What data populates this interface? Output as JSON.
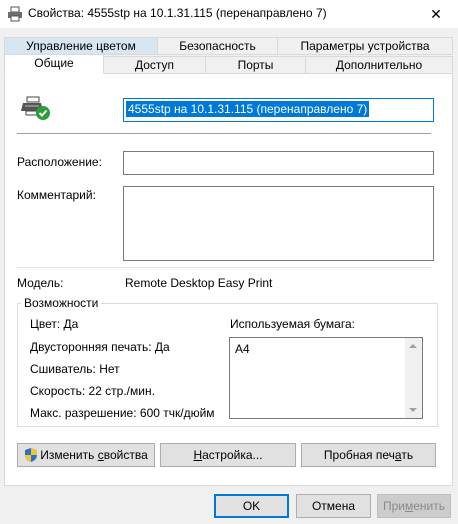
{
  "window": {
    "title": "Свойства: 4555stp на 10.1.31.115 (перенаправлено 7)",
    "close_glyph": "✕",
    "icons": {
      "title": "printer-icon",
      "close": "close-icon"
    }
  },
  "tabs_back": [
    "Управление цветом",
    "Безопасность",
    "Параметры устройства"
  ],
  "tabs_front": [
    "Общие",
    "Доступ",
    "Порты",
    "Дополнительно"
  ],
  "general": {
    "printer_icon": "printer-default-check-icon",
    "printer_name": "4555stp на 10.1.31.115 (перенаправлено 7)",
    "location_label": "Расположение:",
    "location_value": "",
    "comment_label": "Комментарий:",
    "comment_value": "",
    "model_label": "Модель:",
    "model_value": "Remote Desktop Easy Print"
  },
  "features": {
    "title": "Возможности",
    "color": "Цвет: Да",
    "duplex": "Двусторонняя печать: Да",
    "staple": "Сшиватель: Нет",
    "speed": "Скорость: 22 стр./мин.",
    "resolution": "Макс. разрешение: 600 тчк/дюйм",
    "paper_label": "Используемая бумага:",
    "paper_items": [
      "A4"
    ]
  },
  "panel_buttons": {
    "change_props_pre": "Изменить ",
    "change_props_u": "с",
    "change_props_post": "войства",
    "shield_icon": "uac-shield-icon",
    "settings_pre": "",
    "settings_u": "Н",
    "settings_post": "астройка...",
    "test_pre": "Пробная печ",
    "test_u": "а",
    "test_post": "ть"
  },
  "footer": {
    "ok": "OK",
    "cancel": "Отмена",
    "apply_pre": "При",
    "apply_u": "м",
    "apply_post": "енить"
  },
  "colors": {
    "accent": "#0078d7",
    "tab_highlight": "#d8e6f2",
    "check_green": "#2a9d3a"
  }
}
